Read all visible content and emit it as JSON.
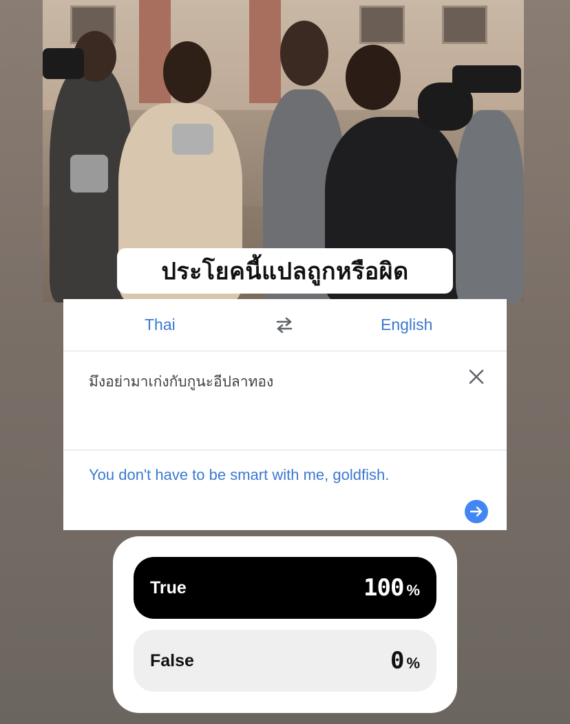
{
  "meme": {
    "caption": "ประโยคนี้แปลถูกหรือผิด"
  },
  "translate": {
    "source_language": "Thai",
    "target_language": "English",
    "source_text": "มึงอย่ามาเก่งกับกูนะอีปลาทอง",
    "translation": "You don't have to be smart with me, goldfish.",
    "icons": {
      "swap": "swap-arrows-icon",
      "clear": "close-icon",
      "go": "arrow-right-icon"
    },
    "accent_color": "#3b78d0"
  },
  "poll": {
    "options": [
      {
        "label": "True",
        "percent": "100",
        "percent_symbol": "%",
        "selected": true
      },
      {
        "label": "False",
        "percent": "0",
        "percent_symbol": "%",
        "selected": false
      }
    ]
  }
}
